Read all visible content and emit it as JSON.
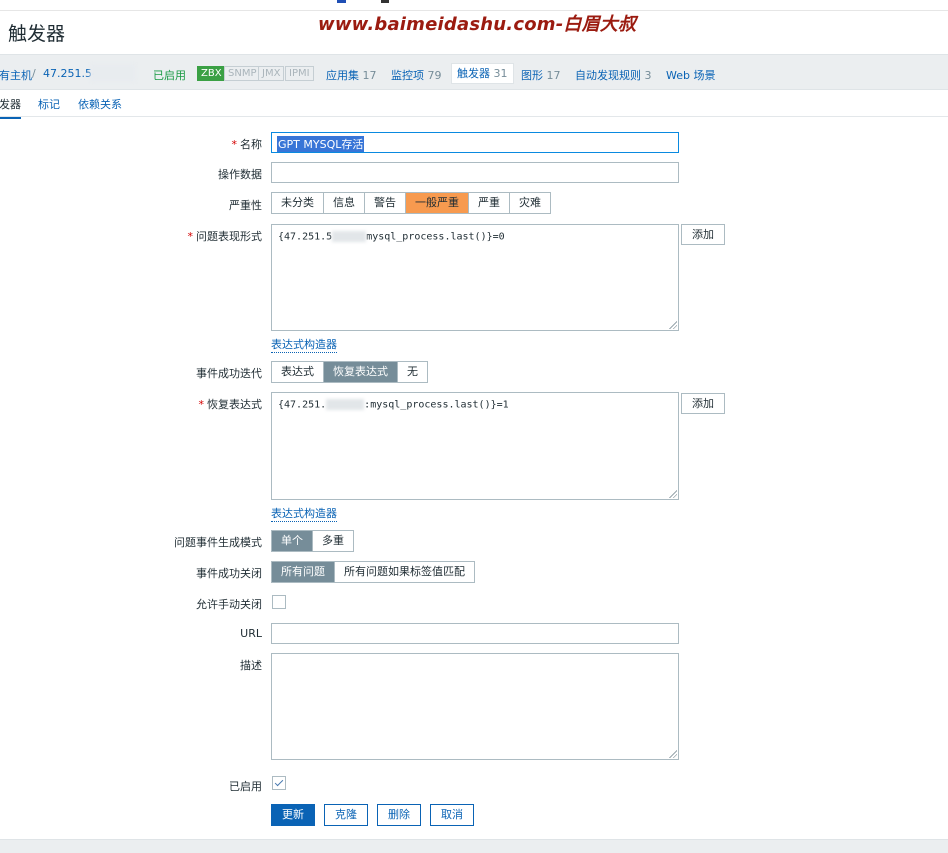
{
  "watermark": "www.baimeidashu.com-白眉大叔",
  "page_title": "触发器",
  "host_nav": {
    "all_hosts": "所有主机",
    "separator": "/",
    "host_ip": "47.251.54",
    "enabled": "已启用",
    "badges": [
      "ZBX",
      "SNMP",
      "JMX",
      "IPMI"
    ],
    "items": [
      {
        "label": "应用集",
        "count": "17"
      },
      {
        "label": "监控项",
        "count": "79"
      },
      {
        "label": "触发器",
        "count": "31"
      },
      {
        "label": "图形",
        "count": "17"
      },
      {
        "label": "自动发现规则",
        "count": "3"
      },
      {
        "label": "Web 场景",
        "count": ""
      }
    ]
  },
  "subtabs": [
    "触发器",
    "标记",
    "依赖关系"
  ],
  "form": {
    "name_label": "名称",
    "name_value": "GPT MYSQL存活",
    "opdata_label": "操作数据",
    "opdata_value": "",
    "severity_label": "严重性",
    "severity_options": [
      "未分类",
      "信息",
      "警告",
      "一般严重",
      "严重",
      "灾难"
    ],
    "severity_selected": "一般严重",
    "problem_expr_label": "问题表现形式",
    "problem_expr_prefix": "{47.251.5",
    "problem_expr_suffix": "mysql_process.last()}=0",
    "add_label": "添加",
    "expr_builder": "表达式构造器",
    "ok_event_label": "事件成功迭代",
    "ok_event_options": [
      "表达式",
      "恢复表达式",
      "无"
    ],
    "ok_event_selected": "恢复表达式",
    "recovery_expr_label": "恢复表达式",
    "recovery_expr_prefix": "{47.251.",
    "recovery_expr_suffix": ":mysql_process.last()}=1",
    "gen_mode_label": "问题事件生成模式",
    "gen_mode_options": [
      "单个",
      "多重"
    ],
    "gen_mode_selected": "单个",
    "ok_close_label": "事件成功关闭",
    "ok_close_options": [
      "所有问题",
      "所有问题如果标签值匹配"
    ],
    "ok_close_selected": "所有问题",
    "manual_close_label": "允许手动关闭",
    "manual_close_checked": false,
    "url_label": "URL",
    "url_value": "",
    "desc_label": "描述",
    "desc_value": "",
    "enabled_label": "已启用",
    "enabled_checked": true
  },
  "buttons": {
    "update": "更新",
    "clone": "克隆",
    "delete": "删除",
    "cancel": "取消"
  }
}
